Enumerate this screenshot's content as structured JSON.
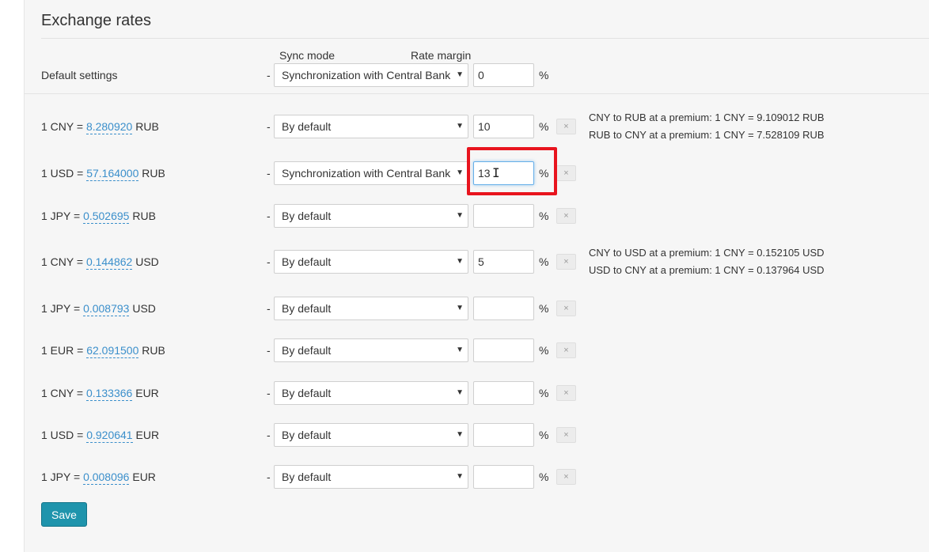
{
  "section": {
    "title": "Exchange rates"
  },
  "headers": {
    "sync_mode": "Sync mode",
    "rate_margin": "Rate margin"
  },
  "default_settings": {
    "label": "Default settings",
    "sync_mode": "Synchronization with Central Bank",
    "margin": "0",
    "dash": "-",
    "percent": "%"
  },
  "rows": [
    {
      "prefix": "1 CNY = ",
      "rate": "8.280920",
      "suffix": " RUB",
      "sync_mode": "By default",
      "margin": "10",
      "dash": "-",
      "percent": "%"
    },
    {
      "prefix": "1 USD = ",
      "rate": "57.164000",
      "suffix": " RUB",
      "sync_mode": "Synchronization with Central Bank",
      "margin": "13",
      "dash": "-",
      "percent": "%"
    },
    {
      "prefix": "1 JPY = ",
      "rate": "0.502695",
      "suffix": " RUB",
      "sync_mode": "By default",
      "margin": "",
      "dash": "-",
      "percent": "%"
    },
    {
      "prefix": "1 CNY = ",
      "rate": "0.144862",
      "suffix": " USD",
      "sync_mode": "By default",
      "margin": "5",
      "dash": "-",
      "percent": "%"
    },
    {
      "prefix": "1 JPY = ",
      "rate": "0.008793",
      "suffix": " USD",
      "sync_mode": "By default",
      "margin": "",
      "dash": "-",
      "percent": "%"
    },
    {
      "prefix": "1 EUR = ",
      "rate": "62.091500",
      "suffix": " RUB",
      "sync_mode": "By default",
      "margin": "",
      "dash": "-",
      "percent": "%"
    },
    {
      "prefix": "1 CNY = ",
      "rate": "0.133366",
      "suffix": " EUR",
      "sync_mode": "By default",
      "margin": "",
      "dash": "-",
      "percent": "%"
    },
    {
      "prefix": "1 USD = ",
      "rate": "0.920641",
      "suffix": " EUR",
      "sync_mode": "By default",
      "margin": "",
      "dash": "-",
      "percent": "%"
    },
    {
      "prefix": "1 JPY = ",
      "rate": "0.008096",
      "suffix": " EUR",
      "sync_mode": "By default",
      "margin": "",
      "dash": "-",
      "percent": "%"
    }
  ],
  "notes": {
    "cny_rub_1": "CNY to RUB at a premium: 1 CNY = 9.109012 RUB",
    "cny_rub_2": "RUB to CNY at a premium: 1 CNY = 7.528109 RUB",
    "cny_usd_1": "CNY to USD at a premium: 1 CNY = 0.152105 USD",
    "cny_usd_2": "USD to CNY at a premium: 1 CNY = 0.137964 USD"
  },
  "icons": {
    "clear": "×",
    "dropdown": "▼"
  },
  "actions": {
    "save_label": "Save"
  },
  "colors": {
    "link": "#3b8fcb",
    "save_button": "#1f94ac",
    "highlight": "#e8141e",
    "focus_border": "#66afe9"
  }
}
